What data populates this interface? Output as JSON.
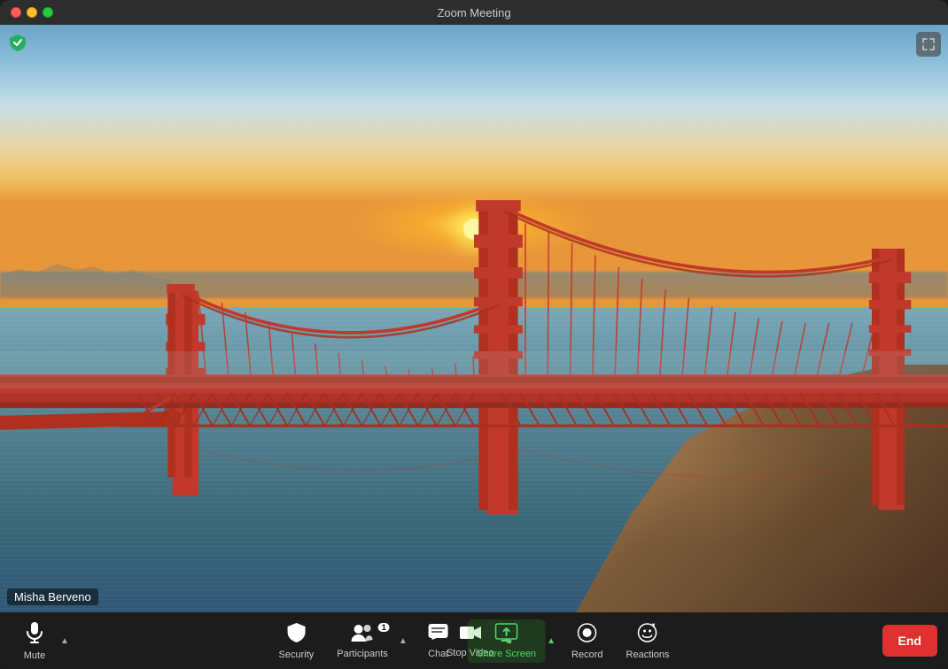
{
  "window": {
    "title": "Zoom Meeting"
  },
  "titlebar": {
    "close": "close",
    "minimize": "minimize",
    "maximize": "maximize"
  },
  "video": {
    "participant_name": "Misha Berveno",
    "background": "Golden Gate Bridge at sunset"
  },
  "toolbar": {
    "mute_label": "Mute",
    "stop_video_label": "Stop Video",
    "security_label": "Security",
    "participants_label": "Participants",
    "participants_count": "1",
    "chat_label": "Chat",
    "share_screen_label": "Share Screen",
    "record_label": "Record",
    "reactions_label": "Reactions",
    "end_label": "End"
  }
}
